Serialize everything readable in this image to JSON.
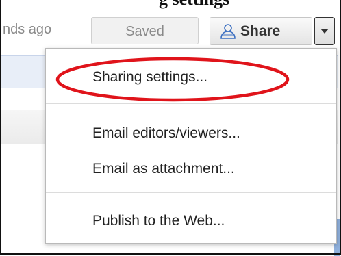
{
  "header": {
    "clipped_title": "g settings"
  },
  "toolbar": {
    "status_text": "nds ago",
    "saved_label": "Saved",
    "share_label": "Share",
    "share_icon": "person-share-icon",
    "dropdown_icon": "chevron-down-icon"
  },
  "share_menu": {
    "items": [
      {
        "label": "Sharing settings...",
        "highlighted": true
      },
      {
        "label": "Email editors/viewers..."
      },
      {
        "label": "Email as attachment..."
      },
      {
        "label": "Publish to the Web..."
      }
    ]
  },
  "colors": {
    "highlight": "#e0141b",
    "page_band_blue": "#e8eef8"
  }
}
